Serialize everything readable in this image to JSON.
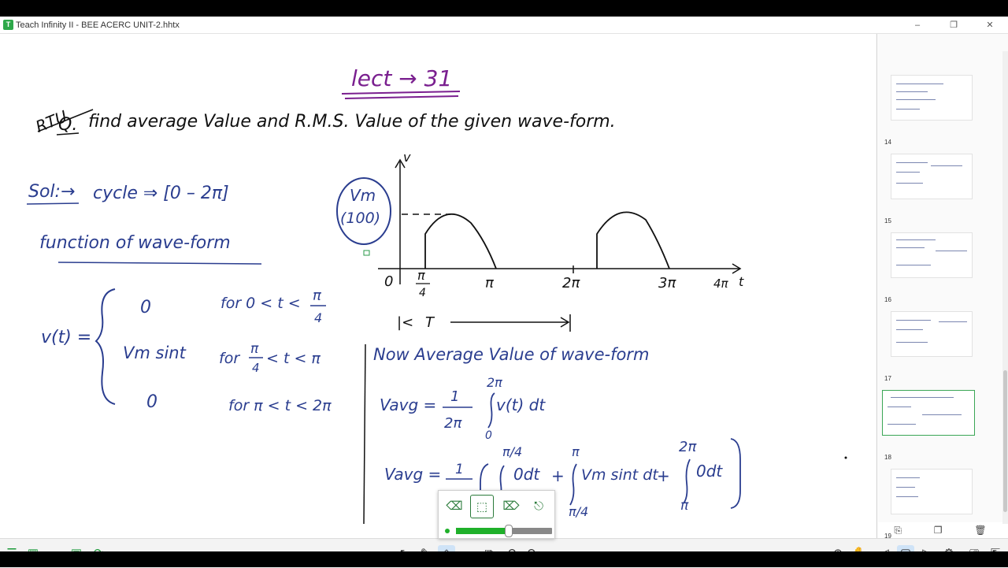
{
  "window": {
    "title": "Teach Infinity II - BEE ACERC UNIT-2.hhtx",
    "controls": [
      "–",
      "❐",
      "✕"
    ]
  },
  "note": {
    "lecture": "lect → 31",
    "university": "RTU",
    "question_prefix": "Q.",
    "question": "find average Value and R.M.S. Value of the given wave-form.",
    "solution_label": "Sol:→",
    "cycle": "cycle ⇒ [0 – 2π]",
    "function_heading": "function of wave-form",
    "vt_label": "v(t) =",
    "cases": [
      {
        "expr": "0",
        "cond_prefix": "for 0 < t <",
        "cond_num": "π",
        "cond_den": "4"
      },
      {
        "expr": "Vm sint",
        "cond_prefix": "for",
        "cond_num": "π",
        "cond_den": "4",
        "cond_suffix": "< t < π"
      },
      {
        "expr": "0",
        "cond_prefix": "for π < t < 2π"
      }
    ],
    "vm_circle_top": "Vm",
    "vm_circle_bottom": "(100)",
    "axis_v": "v",
    "axis_t": "t",
    "ticks": [
      "0",
      "π",
      "2π",
      "3π",
      "4π"
    ],
    "tick_frac_num": "π",
    "tick_frac_den": "4",
    "period_label": "T",
    "average_heading": "Now Average Value of wave-form",
    "vavg_label": "Vavg =",
    "one": "1",
    "two_pi": "2π",
    "zero": "0",
    "integrand1": "v(t) dt",
    "pi_by_4": "π/4",
    "pi": "π",
    "odt": "0dt",
    "plus": "+",
    "vm_sint_dt": "Vm sint dt"
  },
  "sidebar": {
    "pages": [
      {
        "num": "14"
      },
      {
        "num": "15"
      },
      {
        "num": "16"
      },
      {
        "num": "17"
      },
      {
        "num": "18",
        "active": true
      },
      {
        "num": "19"
      }
    ],
    "tools": [
      "page-add-icon",
      "copy-icon",
      "delete-icon"
    ]
  },
  "toolbar_left": [
    "menu-icon",
    "grid-icon",
    "folder-icon",
    "image-icon",
    "play-icon"
  ],
  "toolbar_center": [
    "pointer-icon",
    "pen-icon",
    "eraser-icon",
    "rectangle-icon",
    "insert-icon",
    "undo-icon",
    "redo-icon"
  ],
  "toolbar_right": [
    "zoom-icon",
    "hand-icon",
    "prev-page-icon",
    "page-icon",
    "next-page-icon",
    "settings-icon",
    "present-icon",
    "export-icon"
  ],
  "eraser_popup": {
    "modes": [
      "eraser-icon",
      "area-eraser-icon",
      "stroke-eraser-icon",
      "clear-eraser-icon"
    ],
    "selected": 1,
    "size": 0.55
  },
  "colors": {
    "ink_blue": "#2a3d8f",
    "ink_purple": "#7a1f8f",
    "ink_black": "#111111",
    "accent_green": "#1fb02a"
  }
}
